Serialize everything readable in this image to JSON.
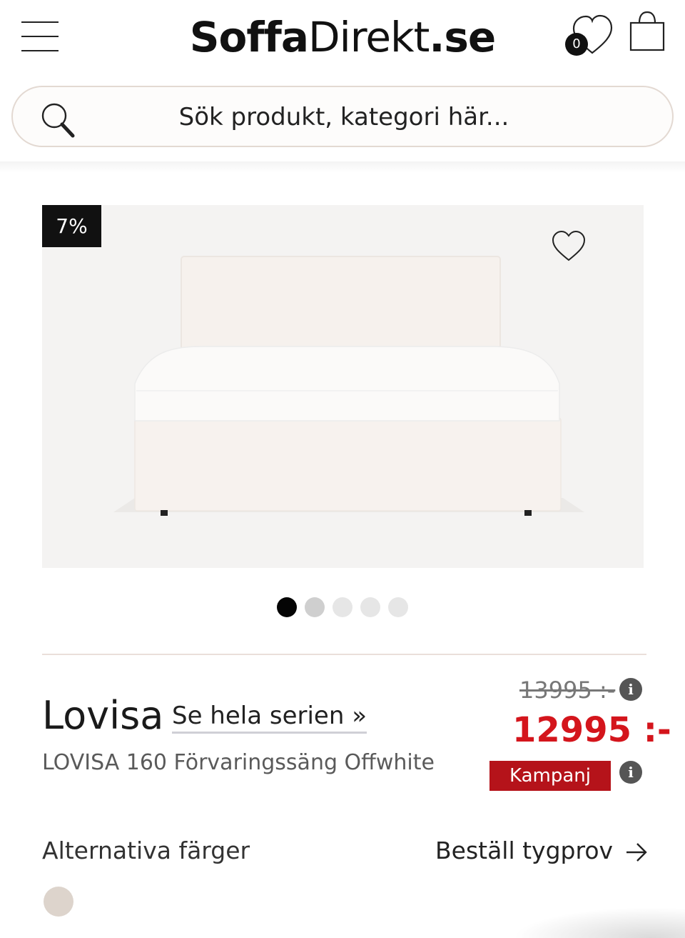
{
  "header": {
    "logo_bold": "Soffa",
    "logo_light": "Direkt",
    "logo_suffix": ".se",
    "wishlist_count": "0",
    "icons": [
      "menu-icon",
      "heart-icon",
      "shopping-bag-icon"
    ]
  },
  "search": {
    "placeholder": "Sök produkt, kategori här..."
  },
  "gallery": {
    "discount_badge": "7%",
    "slide_count": 5,
    "active_slide": 1
  },
  "product": {
    "title": "Lovisa",
    "series_link": "Se hela serien »",
    "subtitle": "LOVISA 160 Förvaringssäng Offwhite",
    "old_price": "13995 :-",
    "price": "12995 :-",
    "campaign_label": "Kampanj"
  },
  "options": {
    "alt_colors_label": "Alternativa färger",
    "order_sample_label": "Beställ tygprov",
    "swatches": [
      {
        "color": "#ddd4cc"
      }
    ]
  },
  "colors": {
    "price_red": "#d4151c",
    "campaign_red": "#b5131a",
    "badge_black": "#111111"
  }
}
